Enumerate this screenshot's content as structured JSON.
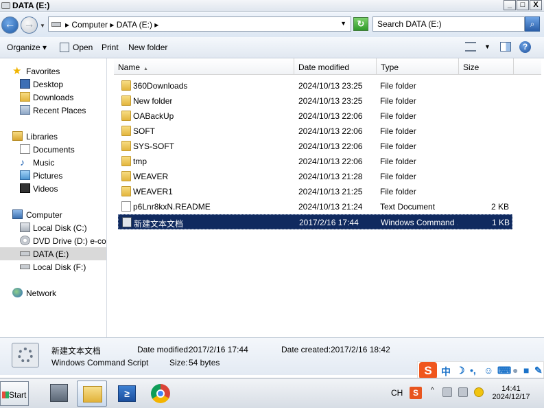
{
  "window": {
    "title": "DATA (E:)",
    "controls": {
      "minimize": "_",
      "maximize": "□",
      "close": "X"
    }
  },
  "address": {
    "back_glyph": "←",
    "forward_glyph": "→",
    "crumbs": "▸ Computer ▸ DATA (E:) ▸",
    "dropdown_glyph": "▼",
    "refresh_glyph": "↻",
    "search_placeholder": "Search DATA (E:)",
    "search_glyph": "⌕"
  },
  "toolbar": {
    "organize": "Organize ▾",
    "open": "Open",
    "print": "Print",
    "new_folder": "New folder",
    "help": "?"
  },
  "nav": {
    "favorites": "Favorites",
    "desktop": "Desktop",
    "downloads": "Downloads",
    "recent": "Recent Places",
    "libraries": "Libraries",
    "documents": "Documents",
    "music": "Music",
    "pictures": "Pictures",
    "videos": "Videos",
    "computer": "Computer",
    "local_c": "Local Disk (C:)",
    "dvd_d": "DVD Drive (D:) e-colog",
    "data_e": "DATA (E:)",
    "local_f": "Local Disk (F:)",
    "network": "Network"
  },
  "columns": {
    "name": "Name",
    "sort_glyph": "▲",
    "date": "Date modified",
    "type": "Type",
    "size": "Size"
  },
  "files": [
    {
      "name": "360Downloads",
      "date": "2024/10/13 23:25",
      "type": "File folder",
      "size": "",
      "kind": "folder"
    },
    {
      "name": "New folder",
      "date": "2024/10/13 23:25",
      "type": "File folder",
      "size": "",
      "kind": "folder"
    },
    {
      "name": "OABackUp",
      "date": "2024/10/13 22:06",
      "type": "File folder",
      "size": "",
      "kind": "folder"
    },
    {
      "name": "SOFT",
      "date": "2024/10/13 22:06",
      "type": "File folder",
      "size": "",
      "kind": "folder"
    },
    {
      "name": "SYS-SOFT",
      "date": "2024/10/13 22:06",
      "type": "File folder",
      "size": "",
      "kind": "folder"
    },
    {
      "name": "tmp",
      "date": "2024/10/13 22:06",
      "type": "File folder",
      "size": "",
      "kind": "folder"
    },
    {
      "name": "WEAVER",
      "date": "2024/10/13 21:28",
      "type": "File folder",
      "size": "",
      "kind": "folder"
    },
    {
      "name": "WEAVER1",
      "date": "2024/10/13 21:25",
      "type": "File folder",
      "size": "",
      "kind": "folder"
    },
    {
      "name": "p6Lnr8kxN.README",
      "date": "2024/10/13 21:24",
      "type": "Text Document",
      "size": "2 KB",
      "kind": "doc"
    },
    {
      "name": "新建文本文档",
      "date": "2017/2/16 17:44",
      "type": "Windows Command ...",
      "size": "1 KB",
      "kind": "cmd",
      "selected": true
    }
  ],
  "details": {
    "name": "新建文本文档",
    "type": "Windows Command Script",
    "modified_label": "Date modified:",
    "modified_value": "2017/2/16 17:44",
    "created_label": "Date created:",
    "created_value": "2017/2/16 18:42",
    "size_label": "Size:",
    "size_value": "54 bytes"
  },
  "taskbar": {
    "start": "Start",
    "ps_glyph": "≥",
    "lang": "CH",
    "sogou": "S",
    "tray_up": "^",
    "time": "14:41",
    "date": "2024/12/17"
  },
  "ime": {
    "logo": "S",
    "mode": "中",
    "moon": "☽",
    "dot": "•,",
    "smile": "☺",
    "keyboard": "⌨"
  },
  "colors": {
    "selection": "#102a5f",
    "folder": "#e8c04d",
    "sogou": "#f0561d"
  }
}
